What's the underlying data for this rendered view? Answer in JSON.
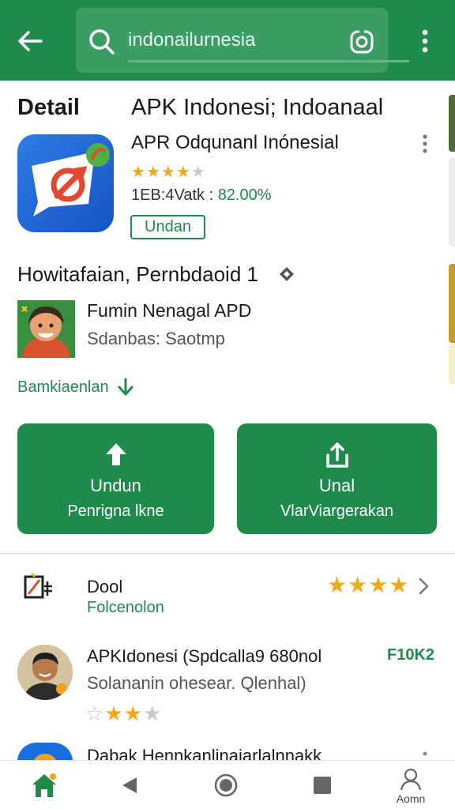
{
  "search": {
    "value": "indonailurnesia"
  },
  "header": {
    "detail_label": "Detail",
    "app_title": "APK Indonesi; Indoanaal"
  },
  "app": {
    "subtitle": "APR Odqunanl Inónesial",
    "rating": 4,
    "stats_prefix": "1EB:4Vatk : ",
    "stats_value": "82.00%",
    "install_chip": "Undan"
  },
  "section": {
    "title": "Howitafaian, Pernbdaoid 1"
  },
  "developer": {
    "name": "Fumin Nenagal APD",
    "subtitle": "Sdanbas: Saotmp"
  },
  "download_link": "Bamkiaenlan",
  "buttons": [
    {
      "line1": "Undun",
      "line2": "Penrigna lkne"
    },
    {
      "line1": "Unal",
      "line2": "VlarViargerakan"
    }
  ],
  "list": [
    {
      "title": "Dool",
      "subtitle": "Folcenolon",
      "rating": 4
    },
    {
      "title": "APKIdonesi (Spdcalla9 680nol",
      "badge": "F10K2",
      "subtitle": "Solananin ohesear. Qlenhal)",
      "rating": 3
    },
    {
      "title": "Dabak Hennkanlinaiarlalnnakk"
    }
  ],
  "bottom_nav": {
    "account_label": "Aomn"
  },
  "colors": {
    "brand_green": "#1f8a4c",
    "star": "#f3a81c",
    "app_icon_blue": "#1a6fe0"
  },
  "icons": [
    "back-arrow-icon",
    "search-icon",
    "lens-icon",
    "more-vert-icon",
    "home-icon",
    "back-triangle-icon",
    "home-circle-icon",
    "recents-square-icon",
    "account-icon"
  ]
}
